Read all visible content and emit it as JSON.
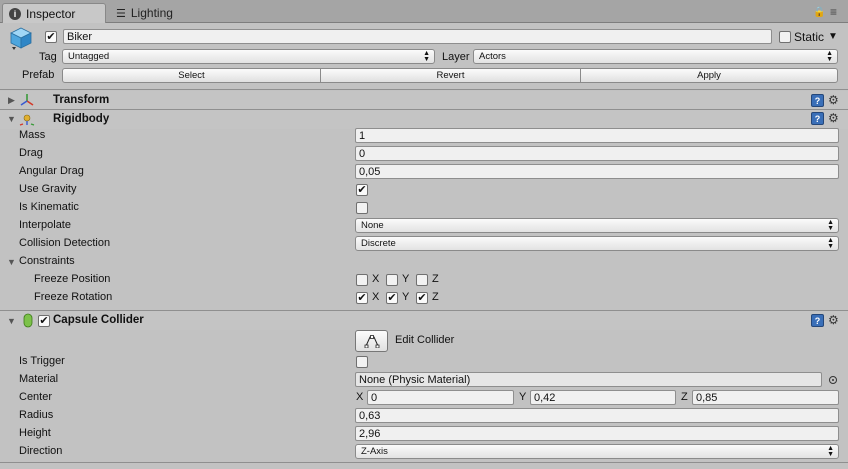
{
  "tabs": [
    {
      "label": "Inspector",
      "icon": "info-icon",
      "active": true
    },
    {
      "label": "Lighting",
      "icon": "lighting-icon",
      "active": false
    }
  ],
  "header": {
    "active": true,
    "name": "Biker",
    "static_label": "Static",
    "static_checked": false,
    "tag_label": "Tag",
    "tag_value": "Untagged",
    "layer_label": "Layer",
    "layer_value": "Actors",
    "prefab_label": "Prefab",
    "prefab_select": "Select",
    "prefab_revert": "Revert",
    "prefab_apply": "Apply"
  },
  "transform": {
    "title": "Transform"
  },
  "rigidbody": {
    "title": "Rigidbody",
    "mass_label": "Mass",
    "mass": "1",
    "drag_label": "Drag",
    "drag": "0",
    "angular_drag_label": "Angular Drag",
    "angular_drag": "0,05",
    "use_gravity_label": "Use Gravity",
    "use_gravity": true,
    "is_kinematic_label": "Is Kinematic",
    "is_kinematic": false,
    "interpolate_label": "Interpolate",
    "interpolate": "None",
    "collision_detection_label": "Collision Detection",
    "collision_detection": "Discrete",
    "constraints_label": "Constraints",
    "freeze_position_label": "Freeze Position",
    "freeze_position": {
      "x": false,
      "y": false,
      "z": false
    },
    "freeze_rotation_label": "Freeze Rotation",
    "freeze_rotation": {
      "x": true,
      "y": true,
      "z": true
    },
    "axis_x": "X",
    "axis_y": "Y",
    "axis_z": "Z"
  },
  "capsule_collider": {
    "title": "Capsule Collider",
    "enabled": true,
    "edit_collider_label": "Edit Collider",
    "is_trigger_label": "Is Trigger",
    "is_trigger": false,
    "material_label": "Material",
    "material": "None (Physic Material)",
    "center_label": "Center",
    "center": {
      "x": "0",
      "y": "0,42",
      "z": "0,85"
    },
    "radius_label": "Radius",
    "radius": "0,63",
    "height_label": "Height",
    "height": "2,96",
    "direction_label": "Direction",
    "direction": "Z-Axis",
    "axis_x": "X",
    "axis_y": "Y",
    "axis_z": "Z"
  },
  "colors": {
    "panel_bg": "#c2c2c2",
    "tab_bar_bg": "#a5a5a5",
    "field_bg": "#f0f0f0",
    "help_icon": "#3a6fb8"
  }
}
